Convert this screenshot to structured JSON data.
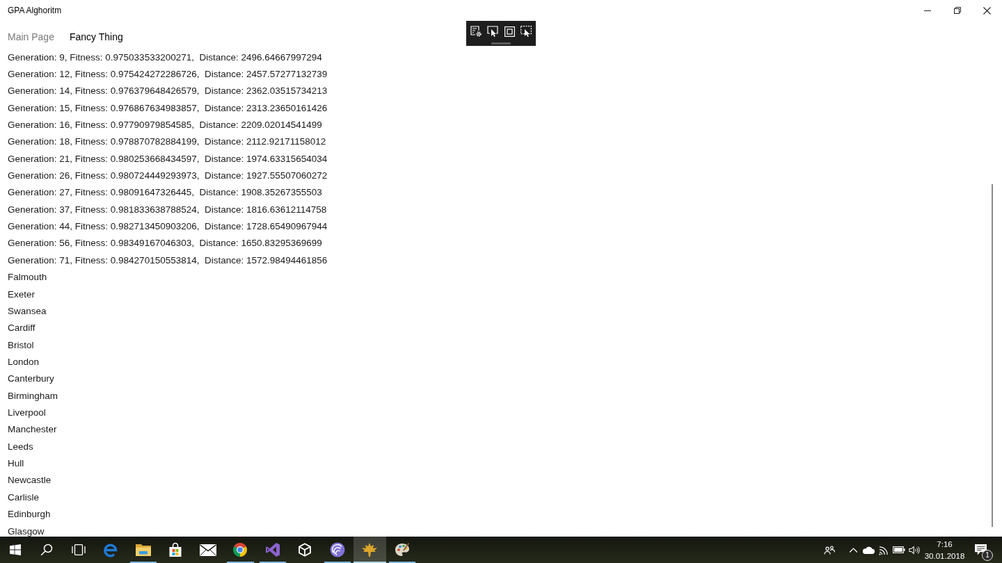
{
  "window": {
    "title": "GPA Alghoritm"
  },
  "tabs": [
    {
      "label": "Main Page",
      "selected": false
    },
    {
      "label": "Fancy Thing",
      "selected": true
    }
  ],
  "log_lines": [
    "Generation: 9, Fitness: 0.975033533200271,  Distance: 2496.64667997294",
    "Generation: 12, Fitness: 0.975424272286726,  Distance: 2457.57277132739",
    "Generation: 14, Fitness: 0.976379648426579,  Distance: 2362.03515734213",
    "Generation: 15, Fitness: 0.976867634983857,  Distance: 2313.23650161426",
    "Generation: 16, Fitness: 0.97790979854585,  Distance: 2209.02014541499",
    "Generation: 18, Fitness: 0.978870782884199,  Distance: 2112.92171158012",
    "Generation: 21, Fitness: 0.980253668434597,  Distance: 1974.63315654034",
    "Generation: 26, Fitness: 0.980724449293973,  Distance: 1927.55507060272",
    "Generation: 27, Fitness: 0.98091647326445,  Distance: 1908.35267355503",
    "Generation: 37, Fitness: 0.981833638788524,  Distance: 1816.63612114758",
    "Generation: 44, Fitness: 0.982713450903206,  Distance: 1728.65490967944",
    "Generation: 56, Fitness: 0.98349167046303,  Distance: 1650.83295369699",
    "Generation: 71, Fitness: 0.984270150553814,  Distance: 1572.98494461856"
  ],
  "cities": [
    "Falmouth",
    "Exeter",
    "Swansea",
    "Cardiff",
    "Bristol",
    "London",
    "Canterbury",
    "Birmingham",
    "Liverpool",
    "Manchester",
    "Leeds",
    "Hull",
    "Newcastle",
    "Carlisle",
    "Edinburgh",
    "Glasgow"
  ],
  "taskbar": {
    "apps": [
      {
        "running": false,
        "selected": false
      },
      {
        "running": true,
        "selected": false
      },
      {
        "running": false,
        "selected": false
      },
      {
        "running": false,
        "selected": false
      },
      {
        "running": true,
        "selected": false
      },
      {
        "running": true,
        "selected": false
      },
      {
        "running": false,
        "selected": false
      },
      {
        "running": true,
        "selected": false
      },
      {
        "running": true,
        "selected": true
      },
      {
        "running": true,
        "selected": false
      }
    ]
  },
  "tray": {
    "time": "7:16",
    "date": "30.01.2018",
    "notification_count": "1"
  }
}
